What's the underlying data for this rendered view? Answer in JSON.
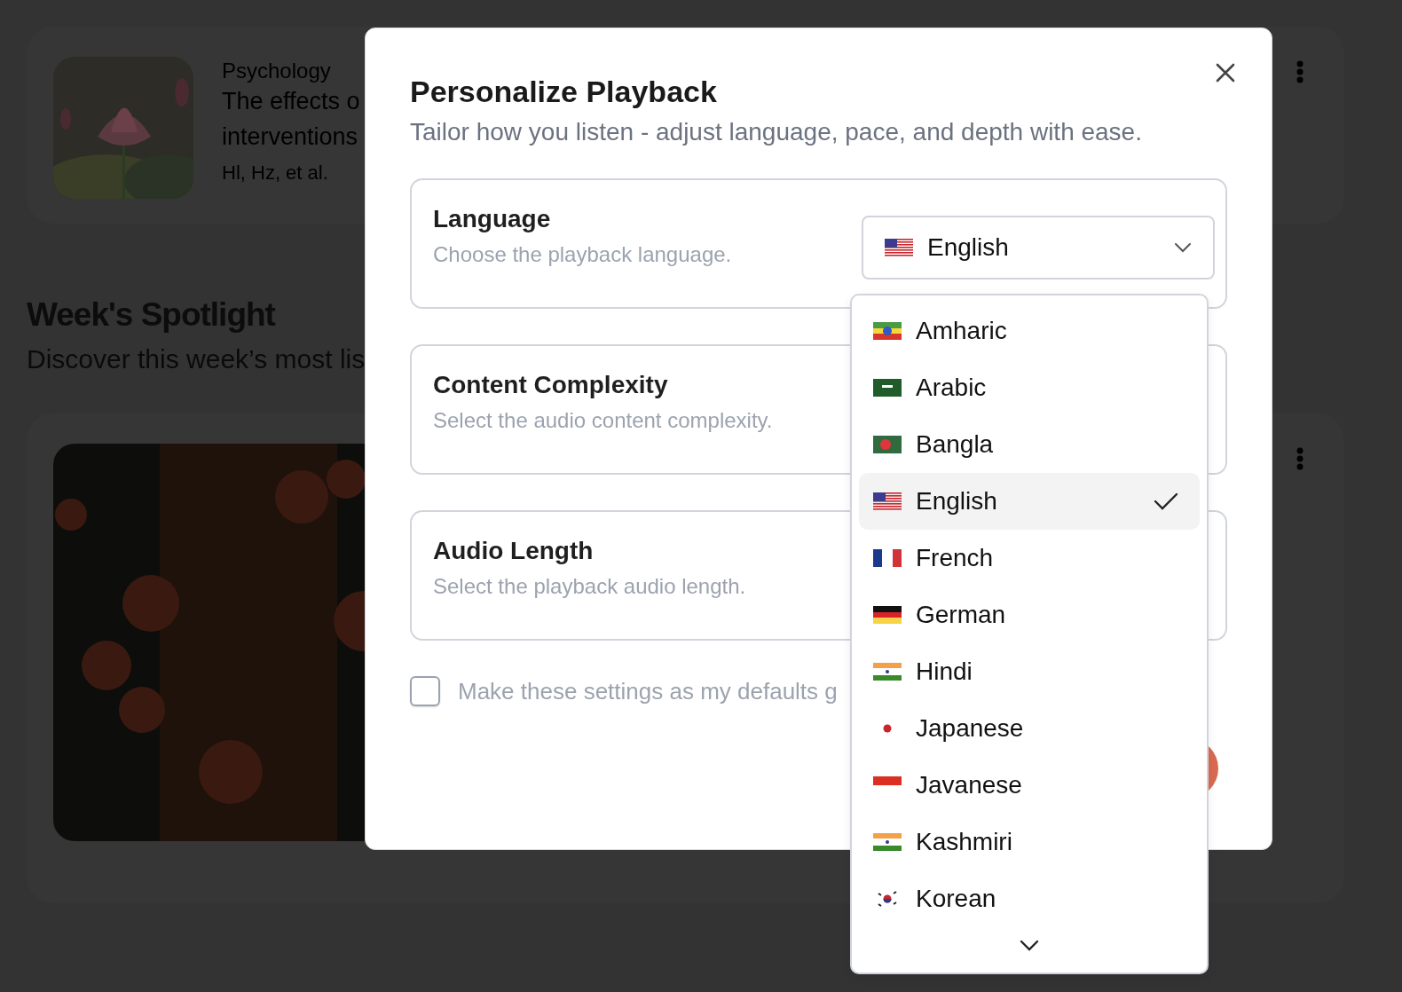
{
  "background": {
    "recent_card": {
      "category": "Psychology",
      "title_lines": [
        "The effects o",
        "interventions"
      ],
      "authors": "Hl, Hz, et al."
    },
    "section": {
      "title": "Week's Spotlight",
      "subtitle": "Discover this week’s most lis"
    }
  },
  "dialog": {
    "title": "Personalize Playback",
    "subtitle": "Tailor how you listen - adjust language, pace, and depth with ease.",
    "settings": [
      {
        "kind": "select",
        "label": "Language",
        "description": "Choose the playback language.",
        "value": {
          "label": "English",
          "kind": "us"
        }
      },
      {
        "kind": "plain",
        "label": "Content Complexity",
        "description": "Select the audio content complexity."
      },
      {
        "kind": "plain",
        "label": "Audio Length",
        "description": "Select the playback audio length."
      }
    ],
    "defaults_checkbox": {
      "label": "Make these settings as my defaults g",
      "checked": false
    }
  },
  "language_menu": {
    "items": [
      {
        "label": "Amharic",
        "kind": "et",
        "selected": false
      },
      {
        "label": "Arabic",
        "kind": "sa",
        "selected": false
      },
      {
        "label": "Bangla",
        "kind": "bd",
        "selected": false
      },
      {
        "label": "English",
        "kind": "us",
        "selected": true
      },
      {
        "label": "French",
        "kind": "fr",
        "selected": false
      },
      {
        "label": "German",
        "kind": "de",
        "selected": false
      },
      {
        "label": "Hindi",
        "kind": "in",
        "selected": false
      },
      {
        "label": "Japanese",
        "kind": "jp",
        "selected": false
      },
      {
        "label": "Javanese",
        "kind": "id",
        "selected": false
      },
      {
        "label": "Kashmiri",
        "kind": "in",
        "selected": false
      },
      {
        "label": "Korean",
        "kind": "kr",
        "selected": false
      }
    ]
  }
}
